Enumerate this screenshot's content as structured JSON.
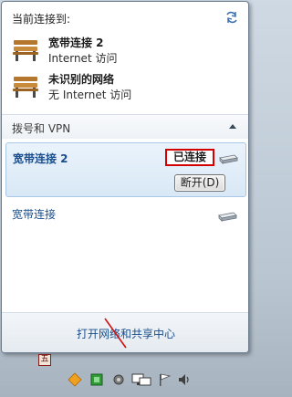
{
  "popup": {
    "header_title": "当前连接到:",
    "connections": [
      {
        "name": "宽带连接 2",
        "status": "Internet 访问"
      },
      {
        "name": "未识别的网络",
        "status": "无 Internet 访问"
      }
    ],
    "section_label": "拨号和 VPN",
    "selected": {
      "name": "宽带连接 2",
      "status": "已连接",
      "disconnect_label": "断开(D)"
    },
    "other_connection": "宽带连接",
    "footer_link": "打开网络和共享中心"
  },
  "taskbar": {
    "lang_indicator": "五"
  },
  "colors": {
    "link": "#1a4e8c",
    "highlight_border": "#d40000"
  }
}
